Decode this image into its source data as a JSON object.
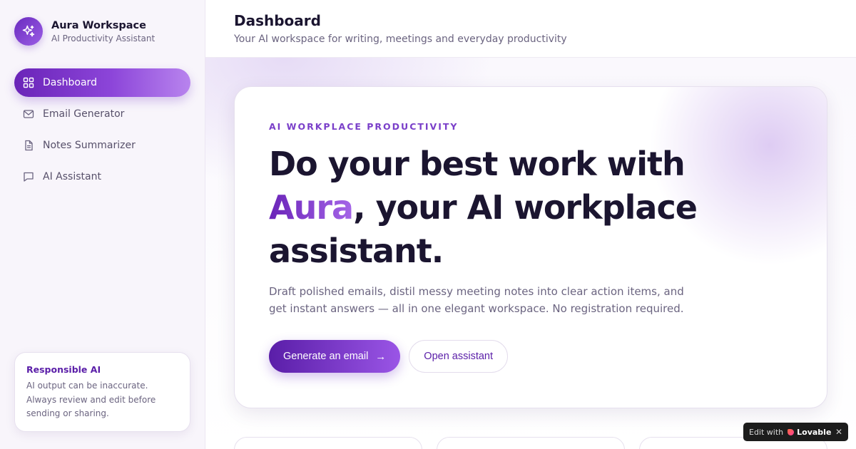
{
  "brand": {
    "title": "Aura Workspace",
    "subtitle": "AI Productivity Assistant",
    "logo_icon": "sparkles-icon"
  },
  "sidebar": {
    "items": [
      {
        "label": "Dashboard",
        "icon": "grid-icon",
        "active": true
      },
      {
        "label": "Email Generator",
        "icon": "mail-icon",
        "active": false
      },
      {
        "label": "Notes Summarizer",
        "icon": "document-icon",
        "active": false
      },
      {
        "label": "AI Assistant",
        "icon": "chat-icon",
        "active": false
      }
    ],
    "notice": {
      "title": "Responsible AI",
      "body": "AI output can be inaccurate. Always review and edit before sending or sharing."
    }
  },
  "header": {
    "title": "Dashboard",
    "subtitle": "Your AI workspace for writing, meetings and everyday productivity"
  },
  "hero": {
    "eyebrow": "AI WORKPLACE PRODUCTIVITY",
    "title_before": "Do your best work with ",
    "title_accent": "Aura",
    "title_after": ", your AI workplace assistant.",
    "description": "Draft polished emails, distil messy meeting notes into clear action items, and get instant answers — all in one elegant workspace. No registration required.",
    "primary_button": "Generate an email",
    "secondary_button": "Open assistant"
  },
  "badge": {
    "prefix": "Edit with",
    "brand": "Lovable",
    "close": "✕"
  },
  "colors": {
    "accent": "#6a24b8",
    "accent_light": "#b884ee",
    "text": "#1b1530",
    "muted": "#6b6480"
  }
}
